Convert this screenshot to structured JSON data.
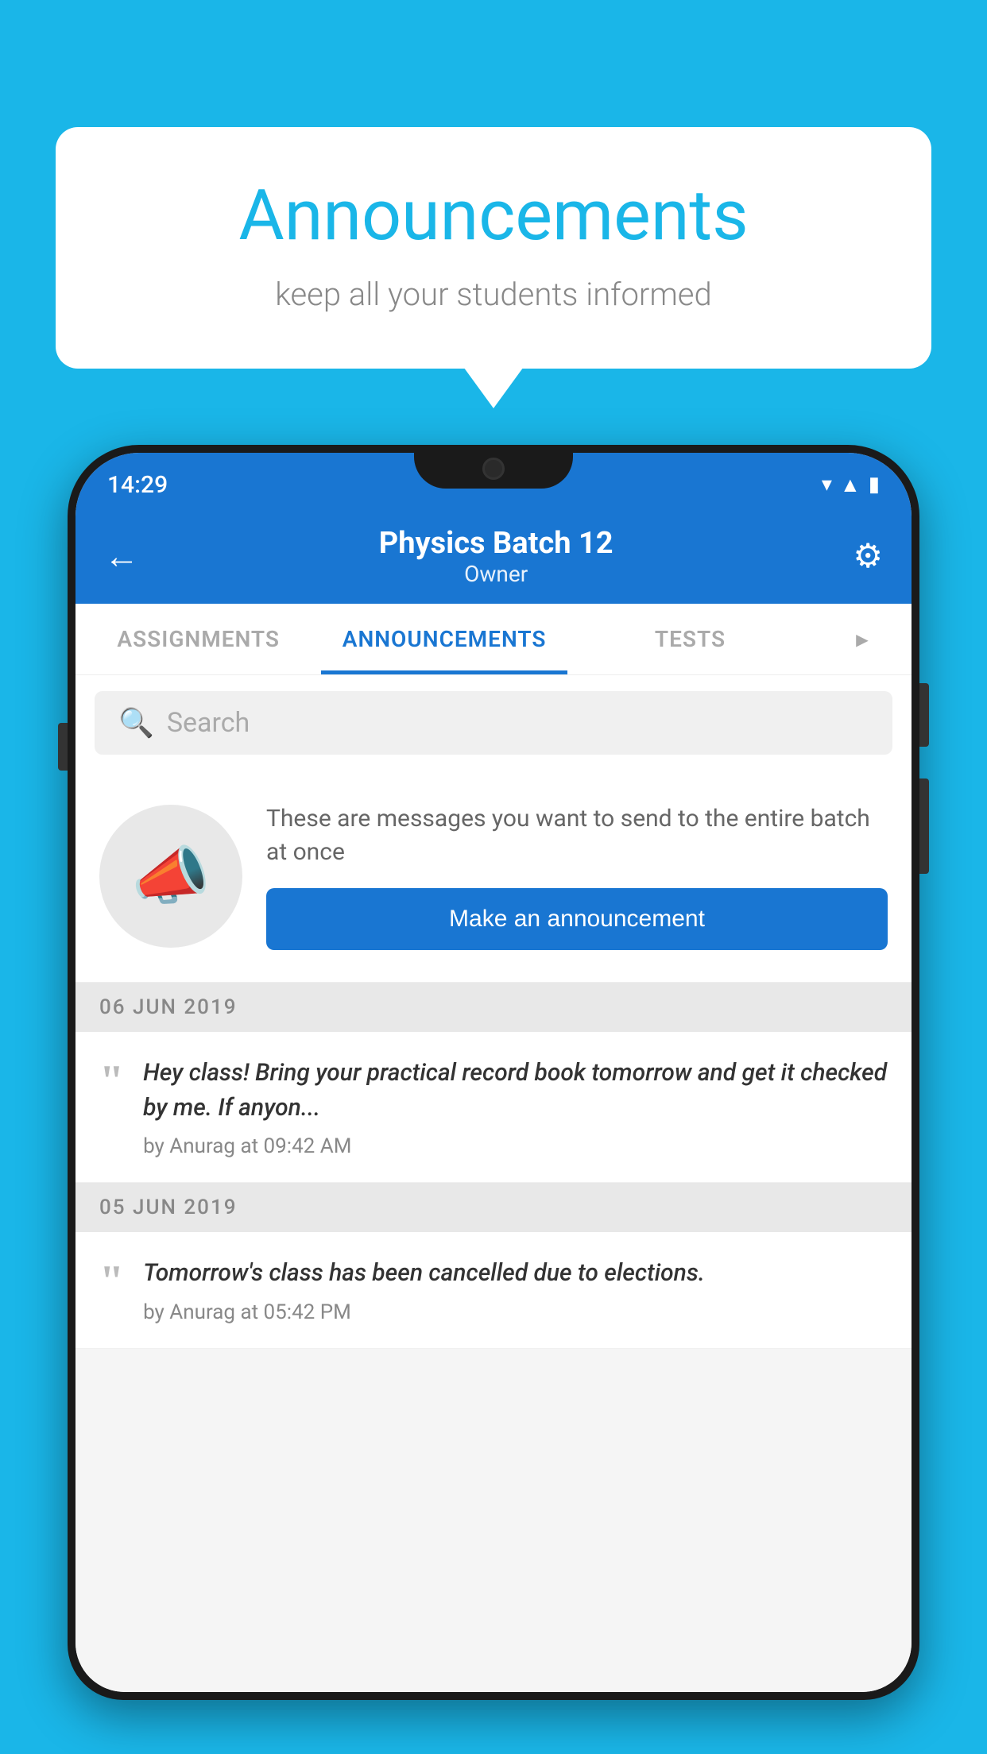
{
  "hero": {
    "title": "Announcements",
    "subtitle": "keep all your students informed"
  },
  "status_bar": {
    "time": "14:29",
    "wifi": "▼",
    "signal": "▲",
    "battery": "▮"
  },
  "app_bar": {
    "title": "Physics Batch 12",
    "subtitle": "Owner",
    "back_label": "←",
    "settings_label": "⚙"
  },
  "tabs": [
    {
      "label": "ASSIGNMENTS",
      "active": false
    },
    {
      "label": "ANNOUNCEMENTS",
      "active": true
    },
    {
      "label": "TESTS",
      "active": false
    },
    {
      "label": "▸",
      "active": false,
      "partial": true
    }
  ],
  "search": {
    "placeholder": "Search"
  },
  "promo": {
    "description": "These are messages you want to send to the entire batch at once",
    "button_label": "Make an announcement"
  },
  "announcements": [
    {
      "date": "06  JUN  2019",
      "text": "Hey class! Bring your practical record book tomorrow and get it checked by me. If anyon...",
      "meta": "by Anurag at 09:42 AM"
    },
    {
      "date": "05  JUN  2019",
      "text": "Tomorrow's class has been cancelled due to elections.",
      "meta": "by Anurag at 05:42 PM"
    }
  ]
}
